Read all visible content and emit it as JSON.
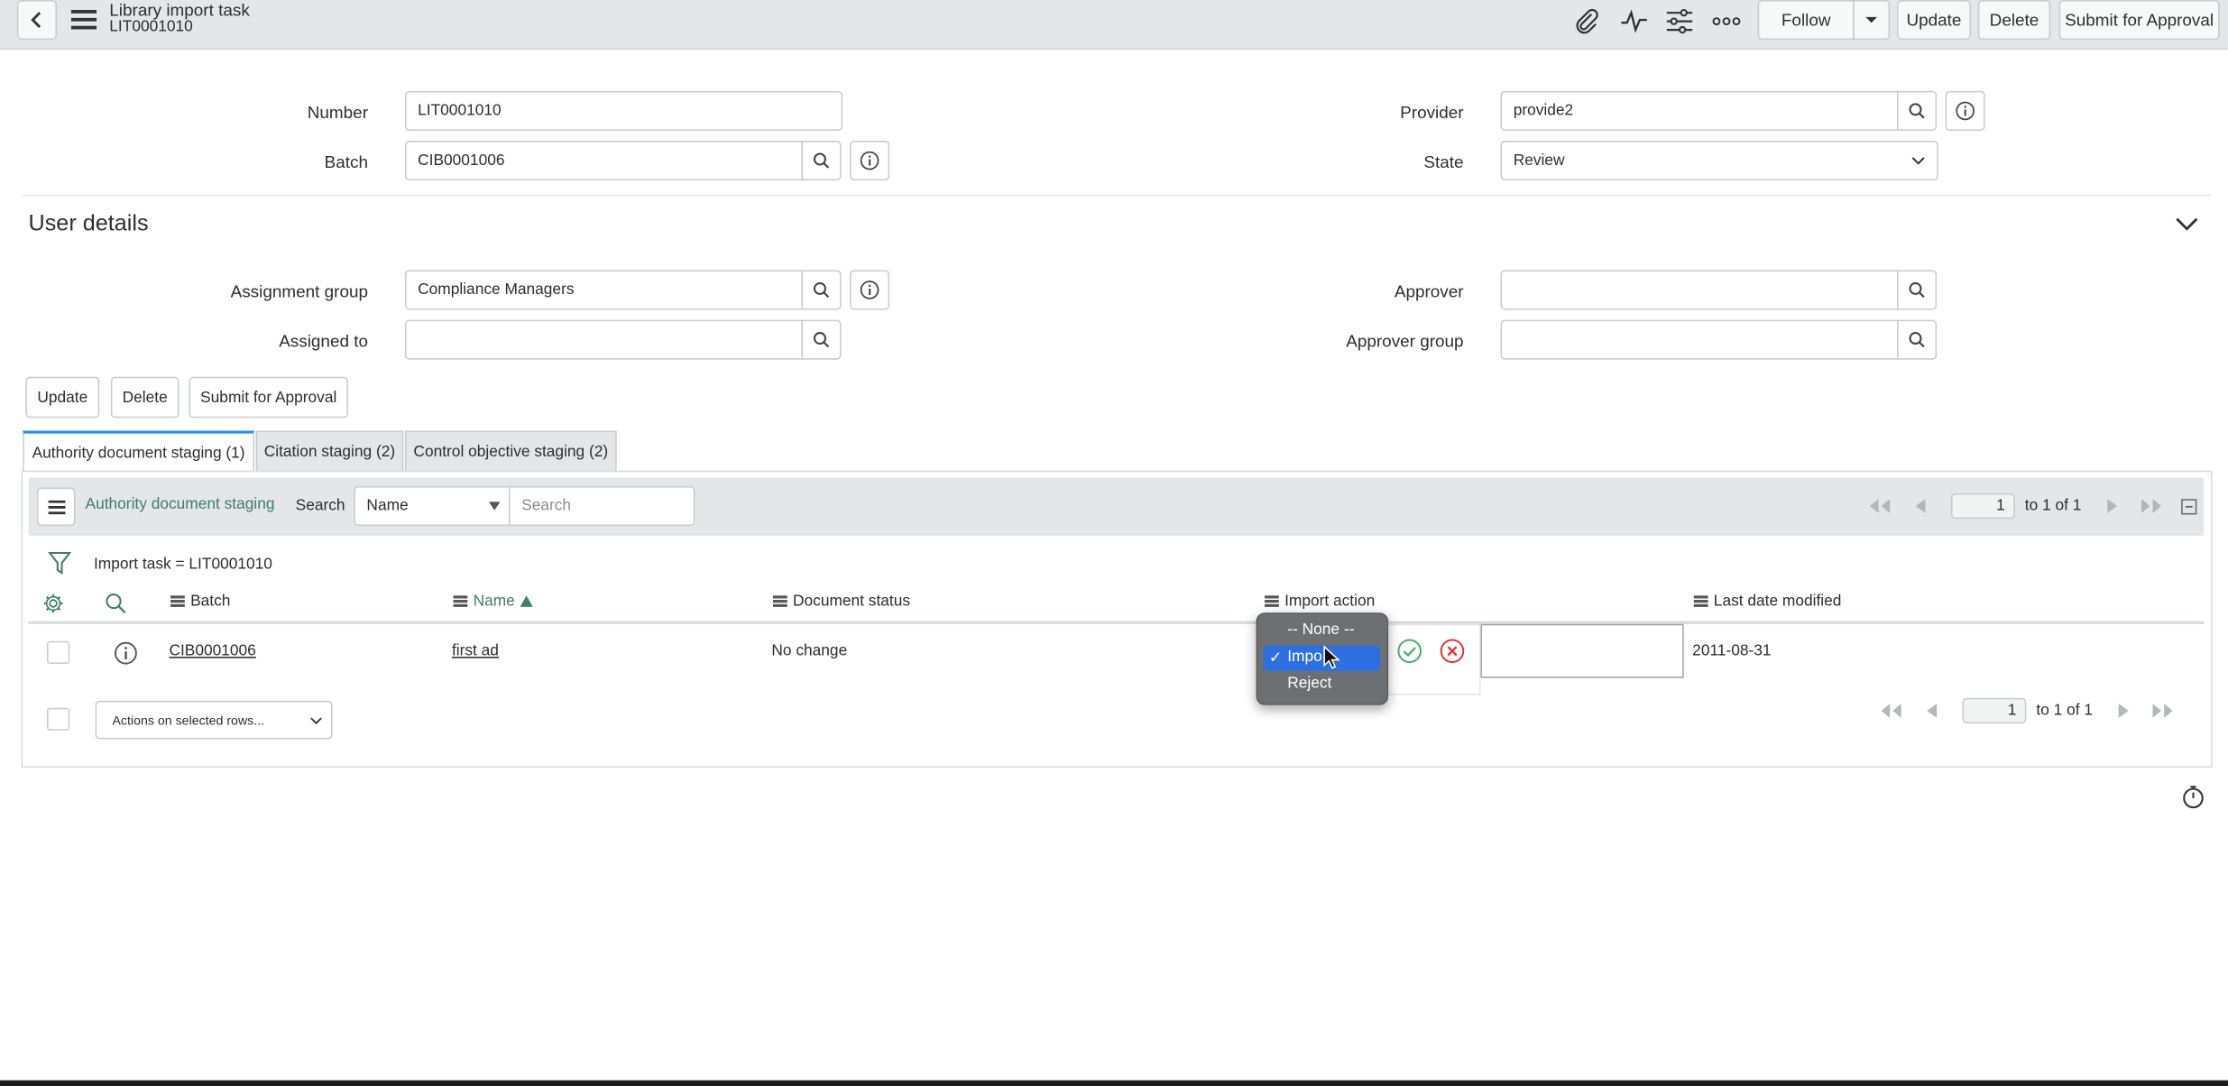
{
  "header": {
    "title": "Library import task",
    "subtitle": "LIT0001010",
    "follow_label": "Follow",
    "update_label": "Update",
    "delete_label": "Delete",
    "submit_label": "Submit for Approval"
  },
  "form": {
    "number_label": "Number",
    "number_value": "LIT0001010",
    "batch_label": "Batch",
    "batch_value": "CIB0001006",
    "provider_label": "Provider",
    "provider_value": "provide2",
    "state_label": "State",
    "state_value": "Review"
  },
  "user_details": {
    "section_title": "User details",
    "assignment_group_label": "Assignment group",
    "assignment_group_value": "Compliance Managers",
    "assigned_to_label": "Assigned to",
    "assigned_to_value": "",
    "approver_label": "Approver",
    "approver_value": "",
    "approver_group_label": "Approver group",
    "approver_group_value": ""
  },
  "form_buttons": {
    "update": "Update",
    "delete": "Delete",
    "submit": "Submit for Approval"
  },
  "tabs": [
    {
      "label": "Authority document staging (1)",
      "active": true
    },
    {
      "label": "Citation staging (2)",
      "active": false
    },
    {
      "label": "Control objective staging (2)",
      "active": false
    }
  ],
  "list": {
    "title": "Authority document staging",
    "search_label": "Search",
    "search_field": "Name",
    "search_placeholder": "Search",
    "page_value": "1",
    "page_of": "to 1 of 1",
    "filter_text": "Import task = LIT0001010",
    "columns": [
      "Batch",
      "Name",
      "Document status",
      "Import action",
      "Last date modified"
    ],
    "rows": [
      {
        "batch": "CIB0001006",
        "name": "first ad",
        "document_status": "No change",
        "import_action": "",
        "last_modified": "2011-08-31"
      }
    ],
    "actions_placeholder": "Actions on selected rows...",
    "footer_page_value": "1",
    "footer_page_of": "to 1 of 1"
  },
  "dropdown": {
    "options": [
      "-- None --",
      "Impo",
      "Reject"
    ],
    "selected_index": 1,
    "check": "✓"
  },
  "colors": {
    "accent": "#278efc",
    "header_bg": "#e4e6e7",
    "link_green": "#3e7f6b",
    "selected_blue": "#2b6fe0",
    "ok_green": "#47b36b",
    "cancel_red": "#d9393a"
  }
}
